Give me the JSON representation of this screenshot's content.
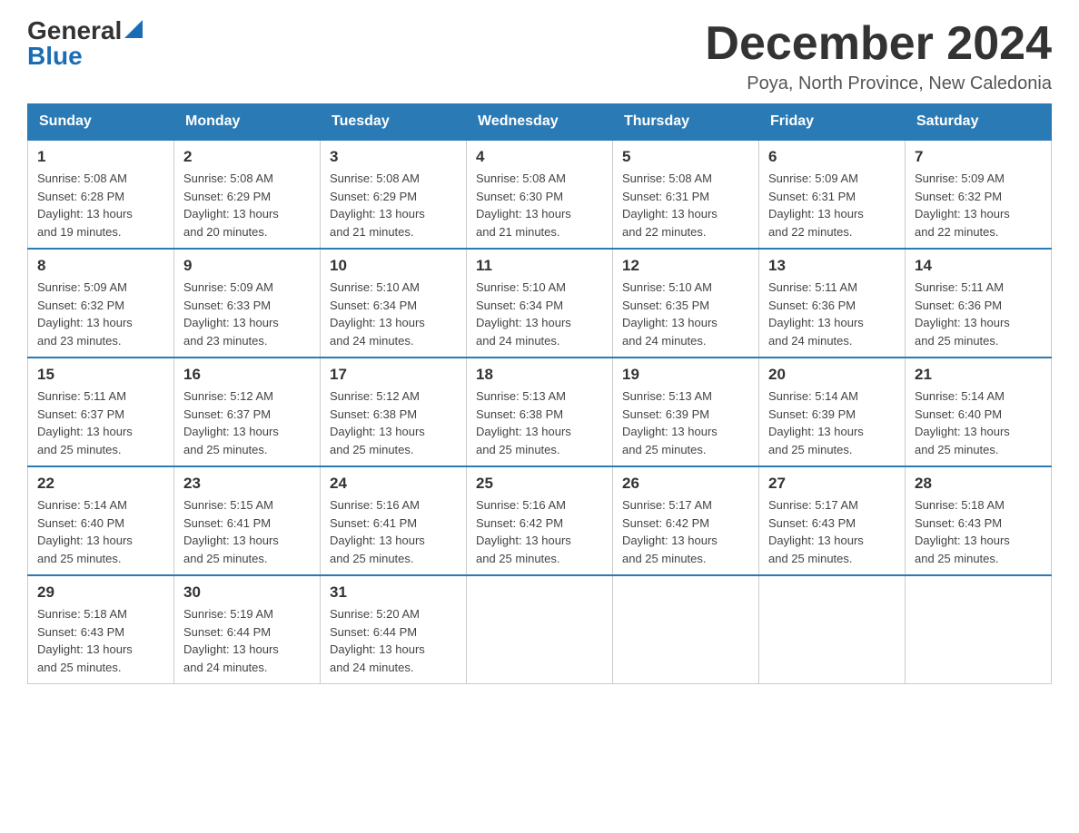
{
  "logo": {
    "general": "General",
    "blue": "Blue"
  },
  "header": {
    "title": "December 2024",
    "subtitle": "Poya, North Province, New Caledonia"
  },
  "days_of_week": [
    "Sunday",
    "Monday",
    "Tuesday",
    "Wednesday",
    "Thursday",
    "Friday",
    "Saturday"
  ],
  "weeks": [
    [
      {
        "day": "1",
        "sunrise": "5:08 AM",
        "sunset": "6:28 PM",
        "daylight": "13 hours and 19 minutes."
      },
      {
        "day": "2",
        "sunrise": "5:08 AM",
        "sunset": "6:29 PM",
        "daylight": "13 hours and 20 minutes."
      },
      {
        "day": "3",
        "sunrise": "5:08 AM",
        "sunset": "6:29 PM",
        "daylight": "13 hours and 21 minutes."
      },
      {
        "day": "4",
        "sunrise": "5:08 AM",
        "sunset": "6:30 PM",
        "daylight": "13 hours and 21 minutes."
      },
      {
        "day": "5",
        "sunrise": "5:08 AM",
        "sunset": "6:31 PM",
        "daylight": "13 hours and 22 minutes."
      },
      {
        "day": "6",
        "sunrise": "5:09 AM",
        "sunset": "6:31 PM",
        "daylight": "13 hours and 22 minutes."
      },
      {
        "day": "7",
        "sunrise": "5:09 AM",
        "sunset": "6:32 PM",
        "daylight": "13 hours and 22 minutes."
      }
    ],
    [
      {
        "day": "8",
        "sunrise": "5:09 AM",
        "sunset": "6:32 PM",
        "daylight": "13 hours and 23 minutes."
      },
      {
        "day": "9",
        "sunrise": "5:09 AM",
        "sunset": "6:33 PM",
        "daylight": "13 hours and 23 minutes."
      },
      {
        "day": "10",
        "sunrise": "5:10 AM",
        "sunset": "6:34 PM",
        "daylight": "13 hours and 24 minutes."
      },
      {
        "day": "11",
        "sunrise": "5:10 AM",
        "sunset": "6:34 PM",
        "daylight": "13 hours and 24 minutes."
      },
      {
        "day": "12",
        "sunrise": "5:10 AM",
        "sunset": "6:35 PM",
        "daylight": "13 hours and 24 minutes."
      },
      {
        "day": "13",
        "sunrise": "5:11 AM",
        "sunset": "6:36 PM",
        "daylight": "13 hours and 24 minutes."
      },
      {
        "day": "14",
        "sunrise": "5:11 AM",
        "sunset": "6:36 PM",
        "daylight": "13 hours and 25 minutes."
      }
    ],
    [
      {
        "day": "15",
        "sunrise": "5:11 AM",
        "sunset": "6:37 PM",
        "daylight": "13 hours and 25 minutes."
      },
      {
        "day": "16",
        "sunrise": "5:12 AM",
        "sunset": "6:37 PM",
        "daylight": "13 hours and 25 minutes."
      },
      {
        "day": "17",
        "sunrise": "5:12 AM",
        "sunset": "6:38 PM",
        "daylight": "13 hours and 25 minutes."
      },
      {
        "day": "18",
        "sunrise": "5:13 AM",
        "sunset": "6:38 PM",
        "daylight": "13 hours and 25 minutes."
      },
      {
        "day": "19",
        "sunrise": "5:13 AM",
        "sunset": "6:39 PM",
        "daylight": "13 hours and 25 minutes."
      },
      {
        "day": "20",
        "sunrise": "5:14 AM",
        "sunset": "6:39 PM",
        "daylight": "13 hours and 25 minutes."
      },
      {
        "day": "21",
        "sunrise": "5:14 AM",
        "sunset": "6:40 PM",
        "daylight": "13 hours and 25 minutes."
      }
    ],
    [
      {
        "day": "22",
        "sunrise": "5:14 AM",
        "sunset": "6:40 PM",
        "daylight": "13 hours and 25 minutes."
      },
      {
        "day": "23",
        "sunrise": "5:15 AM",
        "sunset": "6:41 PM",
        "daylight": "13 hours and 25 minutes."
      },
      {
        "day": "24",
        "sunrise": "5:16 AM",
        "sunset": "6:41 PM",
        "daylight": "13 hours and 25 minutes."
      },
      {
        "day": "25",
        "sunrise": "5:16 AM",
        "sunset": "6:42 PM",
        "daylight": "13 hours and 25 minutes."
      },
      {
        "day": "26",
        "sunrise": "5:17 AM",
        "sunset": "6:42 PM",
        "daylight": "13 hours and 25 minutes."
      },
      {
        "day": "27",
        "sunrise": "5:17 AM",
        "sunset": "6:43 PM",
        "daylight": "13 hours and 25 minutes."
      },
      {
        "day": "28",
        "sunrise": "5:18 AM",
        "sunset": "6:43 PM",
        "daylight": "13 hours and 25 minutes."
      }
    ],
    [
      {
        "day": "29",
        "sunrise": "5:18 AM",
        "sunset": "6:43 PM",
        "daylight": "13 hours and 25 minutes."
      },
      {
        "day": "30",
        "sunrise": "5:19 AM",
        "sunset": "6:44 PM",
        "daylight": "13 hours and 24 minutes."
      },
      {
        "day": "31",
        "sunrise": "5:20 AM",
        "sunset": "6:44 PM",
        "daylight": "13 hours and 24 minutes."
      },
      null,
      null,
      null,
      null
    ]
  ],
  "labels": {
    "sunrise": "Sunrise:",
    "sunset": "Sunset:",
    "daylight": "Daylight:"
  }
}
